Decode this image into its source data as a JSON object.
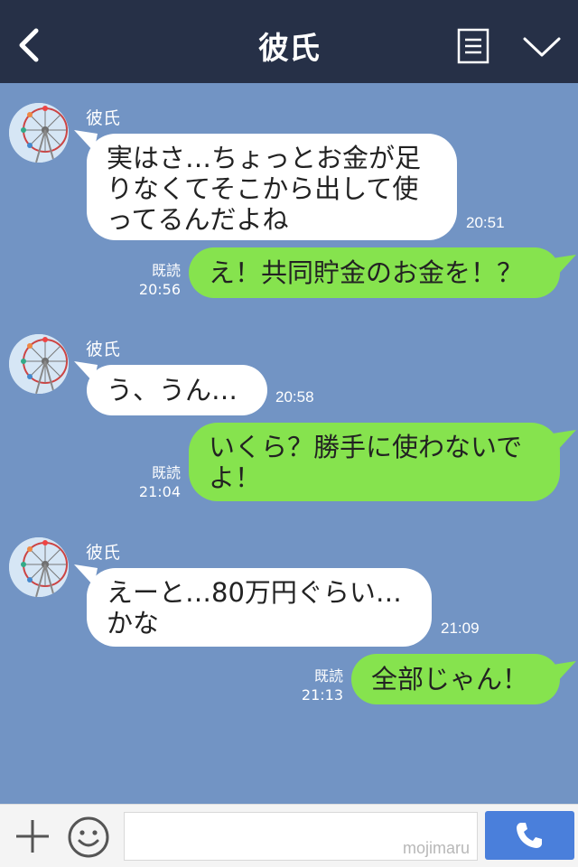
{
  "header": {
    "title": "彼氏",
    "back_icon": "chevron-left-icon",
    "menu_icon": "menu-icon",
    "collapse_icon": "chevron-down-icon"
  },
  "messages": [
    {
      "from": "彼氏",
      "side": "left",
      "lines": [
        "実はさ…ちょっとお金が足",
        "りなくてそこから出して使",
        "ってるんだよね"
      ],
      "time": "20:51"
    },
    {
      "side": "right",
      "lines": [
        "え！共同貯金のお金を！？"
      ],
      "read": "既読",
      "time": "20:56"
    },
    {
      "from": "彼氏",
      "side": "left",
      "lines": [
        "う、うん…"
      ],
      "time": "20:58"
    },
    {
      "side": "right",
      "lines": [
        "いくら？勝手に使わないで",
        "よ！"
      ],
      "read": "既読",
      "time": "21:04"
    },
    {
      "from": "彼氏",
      "side": "left",
      "lines": [
        "えーと…80万円ぐらい…",
        "かな"
      ],
      "time": "21:09"
    },
    {
      "side": "right",
      "lines": [
        "全部じゃん！"
      ],
      "read": "既読",
      "time": "21:13"
    }
  ],
  "footer": {
    "plus_icon": "plus-icon",
    "smile_icon": "smile-icon",
    "input_value": "",
    "watermark": "mojimaru",
    "send_icon": "phone-icon"
  },
  "colors": {
    "header_bg": "#263047",
    "chat_bg": "#7294c4",
    "sent_bubble": "#86e34e",
    "received_bubble": "#ffffff",
    "send_button": "#4a7fdb"
  }
}
